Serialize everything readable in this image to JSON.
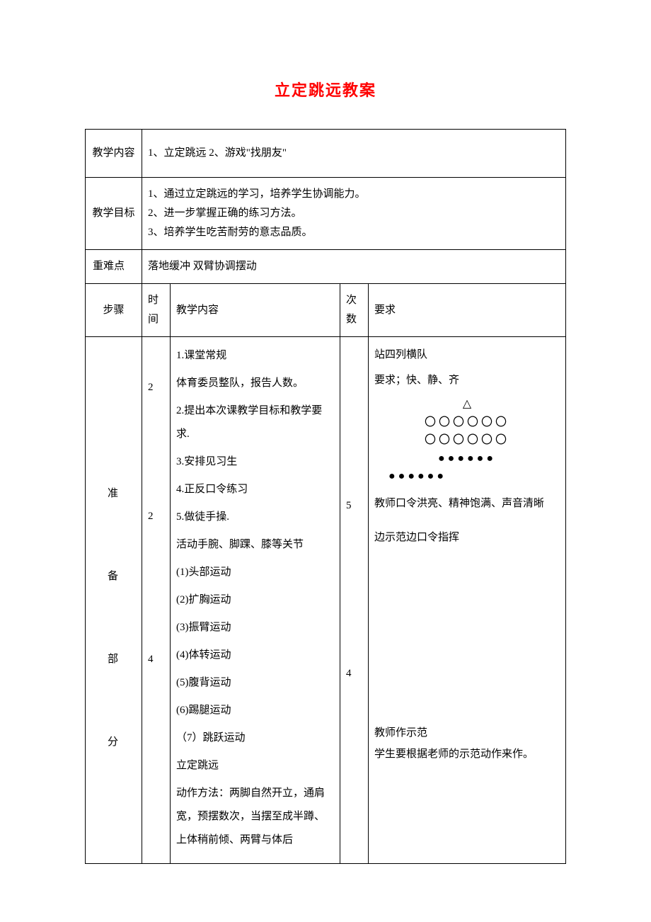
{
  "title": "立定跳远教案",
  "labels": {
    "teaching_content": "教学内容",
    "teaching_goal": "教学目标",
    "key_difficulty": "重难点",
    "step": "步骤",
    "time": "时间",
    "content": "教学内容",
    "count": "次数",
    "requirement": "要求"
  },
  "header": {
    "content_line": "1、立定跳远                 2、游戏\"找朋友\"",
    "goal_1": "1、通过立定跳远的学习，培养学生协调能力。",
    "goal_2": "2、进一步掌握正确的练习方法。",
    "goal_3": "3、培养学生吃苦耐劳的意志品质。",
    "difficulty": "落地缓冲   双臂协调摆动"
  },
  "steps": {
    "prep_label_1": "准",
    "prep_label_2": "备",
    "prep_label_3": "部",
    "prep_label_4": "分",
    "time_1": "2",
    "time_2": "2",
    "time_3": "4",
    "count_1": "5",
    "count_2": "4",
    "content": {
      "c1": "1.课堂常规",
      "c2": "体育委员整队，报告人数。",
      "c3": "2.提出本次课教学目标和教学要求.",
      "c4": "3.安排见习生",
      "c5": "4.正反口令练习",
      "c6": "5.做徒手操.",
      "c7": " 活动手腕、脚踝、膝等关节",
      "c8": " (1)头部运动",
      "c9": " (2)扩胸运动",
      "c10": " (3)振臂运动",
      "c11": " (4)体转运动",
      "c12": " (5)腹背运动",
      "c13": " (6)踢腿运动",
      "c14": "（7）跳跃运动",
      "c15": "立定跳远",
      "c16": "动作方法：两脚自然开立，通肩宽，预摆数次，当摆至成半蹲、上体稍前倾、两臂与体后"
    },
    "requirement": {
      "r1": "站四列横队",
      "r2": "要求；快、静、齐",
      "tri": "△",
      "circles_1": "〇〇〇〇〇〇",
      "circles_2": "〇〇〇〇〇〇",
      "dots_1": "●●●●●●",
      "dots_2": "●●●●●●",
      "r3": "教师口令洪亮、精神饱满、声音清晰",
      "r4": "边示范边口令指挥",
      "r5": "教师作示范",
      "r6": "学生要根据老师的示范动作来作。"
    }
  }
}
